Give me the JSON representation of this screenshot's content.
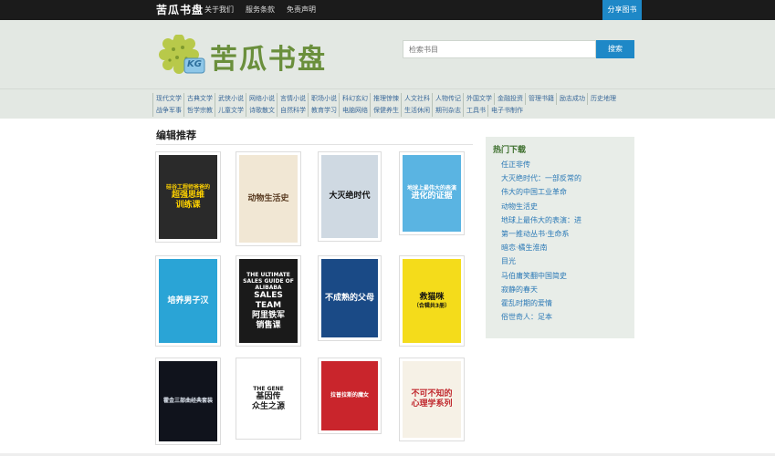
{
  "topbar": {
    "brand": "苦瓜书盘",
    "nav": [
      "关于我们",
      "服务条款",
      "免责声明"
    ],
    "share": "分享图书"
  },
  "header": {
    "logo_text": "苦瓜书盘",
    "logo_badge": "KG",
    "search_placeholder": "检索书目",
    "search_button": "搜索"
  },
  "categories": [
    "现代文学",
    "古典文学",
    "武侠小说",
    "网络小说",
    "言情小说",
    "职场小说",
    "科幻玄幻",
    "推理惊悚",
    "人文社科",
    "人物传记",
    "外国文学",
    "金融投资",
    "管理书籍",
    "励志成功",
    "历史地理",
    "战争军事",
    "哲学宗教",
    "儿童文学",
    "诗歌散文",
    "自然科学",
    "教育学习",
    "电脑网络",
    "保健养生",
    "生活休闲",
    "期刊杂志",
    "工具书",
    "电子书制作"
  ],
  "editor": {
    "title": "编辑推荐",
    "books": [
      {
        "cover_lines": [
          "硅谷工程师爸爸的",
          "超强思维",
          "训练课"
        ],
        "bg": "#2a2a2a",
        "fg": "#ffd200"
      },
      {
        "cover_lines": [
          "动物生活史"
        ],
        "bg": "#f1e7d4",
        "fg": "#5a3c22"
      },
      {
        "cover_lines": [
          "大灭绝时代"
        ],
        "bg": "#cfd9e2",
        "fg": "#111111"
      },
      {
        "cover_lines": [
          "地球上最伟大的表演",
          "进化的证据"
        ],
        "bg": "#5ab4e2",
        "fg": "#ffffff"
      },
      {
        "cover_lines": [
          "培养男子汉"
        ],
        "bg": "#2aa4d6",
        "fg": "#ffffff"
      },
      {
        "cover_lines": [
          "THE ULTIMATE",
          "SALES GUIDE OF",
          "ALIBABA",
          "SALES",
          "TEAM",
          "阿里铁军",
          "销售课"
        ],
        "bg": "#1a1a1a",
        "fg": "#ffffff"
      },
      {
        "cover_lines": [
          "不成熟的父母"
        ],
        "bg": "#1a4a86",
        "fg": "#ffffff"
      },
      {
        "cover_lines": [
          "救猫咪",
          "（合辑共3册）"
        ],
        "bg": "#f4dc1b",
        "fg": "#111111"
      },
      {
        "cover_lines": [
          "霍金三部曲经典套装"
        ],
        "bg": "#10131c",
        "fg": "#dfe6f0"
      },
      {
        "cover_lines": [
          "THE GENE",
          "基因传",
          "众生之源"
        ],
        "bg": "#ffffff",
        "fg": "#222222"
      },
      {
        "cover_lines": [
          "拉普拉斯的魔女"
        ],
        "bg": "#c9252c",
        "fg": "#ffffff"
      },
      {
        "cover_lines": [
          "不可不知的",
          "心理学系列"
        ],
        "bg": "#f6f1e6",
        "fg": "#c0282d"
      }
    ]
  },
  "hot": {
    "title": "热门下载",
    "items": [
      "任正非传",
      "大灭绝时代：一部反常的",
      "伟大的中国工业革命",
      "动物生活史",
      "地球上最伟大的表演：进",
      "第一推动丛书·生命系",
      "暗恋·橘生淮南",
      "目光",
      "马伯庸笑翻中国简史",
      "寂静的春天",
      "霍乱时期的爱情",
      "俗世奇人：足本"
    ]
  },
  "colors": {
    "accent": "#1e88c7",
    "header_bg": "#e3e8e3",
    "topbar_bg": "#1b1b1b",
    "logo_green": "#6a8f3c",
    "hot_title": "#3d6f2d",
    "link": "#2b79b6"
  }
}
